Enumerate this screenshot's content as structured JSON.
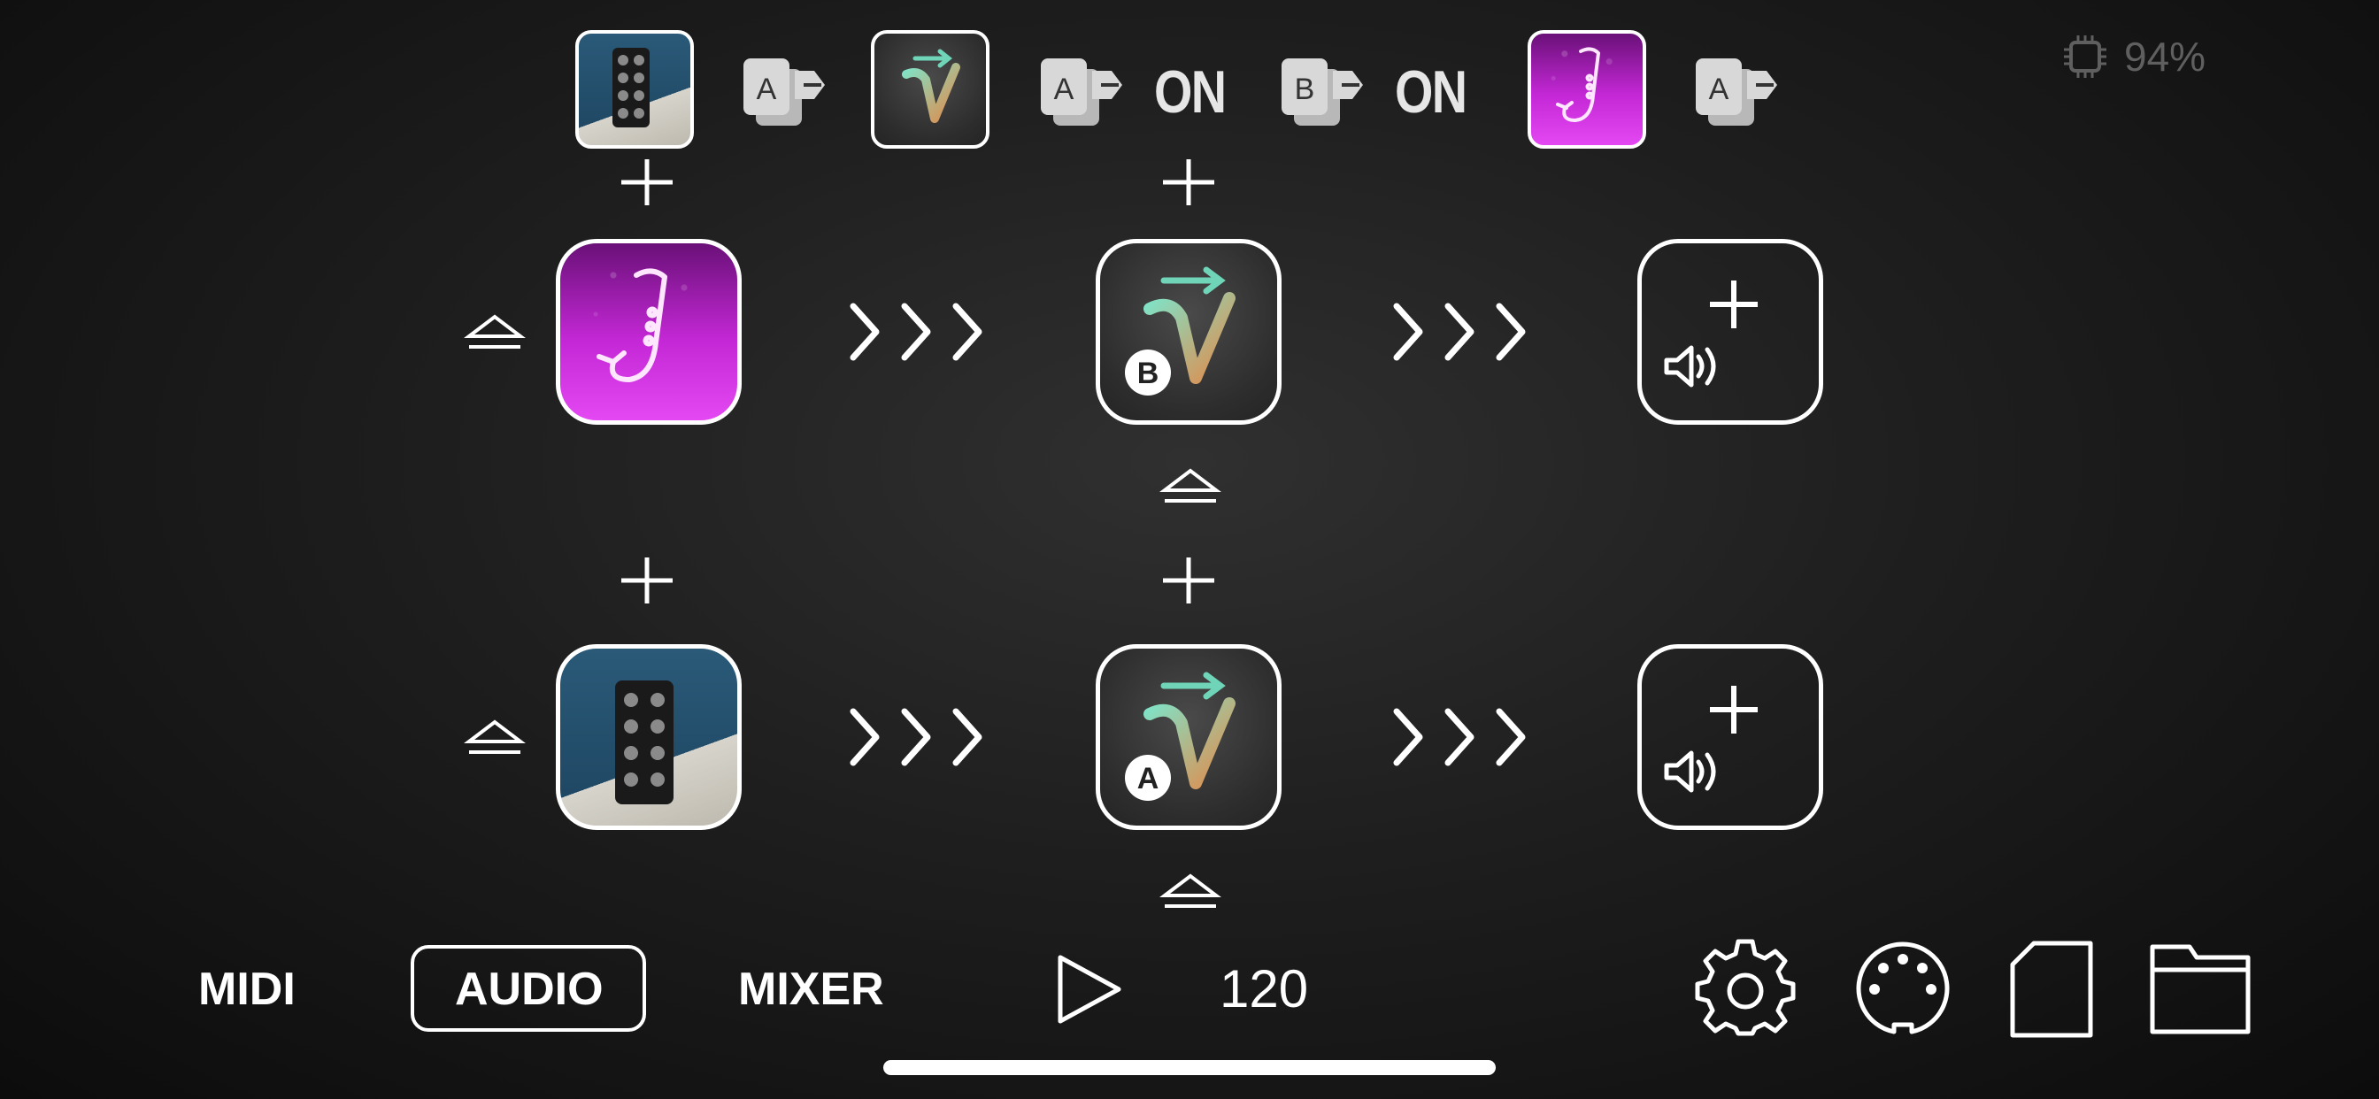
{
  "status": {
    "cpu_icon": "cpu-chip-icon",
    "cpu_percent": "94%"
  },
  "top_strip": {
    "items": [
      {
        "type": "app-thumbnail",
        "icon": "dice-app-icon"
      },
      {
        "type": "route-badge",
        "icon": "route-a-icon",
        "letter": "A"
      },
      {
        "type": "app-thumbnail",
        "icon": "v-synth-app-icon"
      },
      {
        "type": "route-badge",
        "icon": "route-a-icon",
        "letter": "A"
      },
      {
        "type": "state",
        "label": "ON"
      },
      {
        "type": "route-badge",
        "icon": "route-b-icon",
        "letter": "B"
      },
      {
        "type": "state",
        "label": "ON"
      },
      {
        "type": "app-thumbnail",
        "icon": "sax-app-icon"
      },
      {
        "type": "route-badge",
        "icon": "route-a-icon",
        "letter": "A"
      }
    ]
  },
  "chains": [
    {
      "input": {
        "icon": "sax-app-icon"
      },
      "effect": {
        "icon": "v-synth-app-icon",
        "badge": "B"
      },
      "output": {
        "icon": "speaker-plus-icon"
      }
    },
    {
      "input": {
        "icon": "dice-app-icon"
      },
      "effect": {
        "icon": "v-synth-app-icon",
        "badge": "A"
      },
      "output": {
        "icon": "speaker-plus-icon"
      }
    }
  ],
  "bottom_bar": {
    "tabs": [
      {
        "label": "MIDI",
        "active": false
      },
      {
        "label": "AUDIO",
        "active": true
      },
      {
        "label": "MIXER",
        "active": false
      }
    ],
    "tempo": "120",
    "icons": [
      "play-icon",
      "gear-icon",
      "midi-din-icon",
      "file-icon",
      "folder-icon"
    ]
  },
  "colors": {
    "background": "#1b1b1b",
    "foreground": "#ffffff",
    "sax_accent": "#c428d6",
    "cpu_text": "#5f5f5f"
  }
}
